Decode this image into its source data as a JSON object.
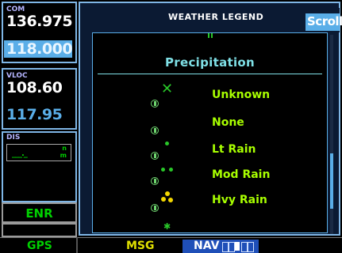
{
  "com": {
    "label": "COM",
    "active": "136.975",
    "standby": "118.000"
  },
  "vloc": {
    "label": "VLOC",
    "active": "108.60",
    "standby": "117.95"
  },
  "dis": {
    "label": "DIS",
    "value": "___._",
    "unit_top": "n",
    "unit_bottom": "m"
  },
  "mode": {
    "label": "ENR"
  },
  "legend": {
    "title": "WEATHER LEGEND",
    "scroll_label": "Scroll",
    "section_title": "Precipitation",
    "rows": [
      {
        "label": "Unknown",
        "symbol": "x-mark"
      },
      {
        "label": "None",
        "symbol": "none"
      },
      {
        "label": "Lt Rain",
        "symbol": "one-green-dot"
      },
      {
        "label": "Mod Rain",
        "symbol": "two-green-dots"
      },
      {
        "label": "Hvy Rain",
        "symbol": "three-yellow-dots"
      }
    ]
  },
  "bottom": {
    "gps_label": "GPS",
    "msg_label": "MSG",
    "nav_label": "NAV"
  },
  "colors": {
    "panel_bg": "#0b1a33",
    "accent_blue": "#5aaee8",
    "legend_text": "#a8ff00",
    "heavy_rain": "#f2d600",
    "light_rain": "#29c729"
  }
}
